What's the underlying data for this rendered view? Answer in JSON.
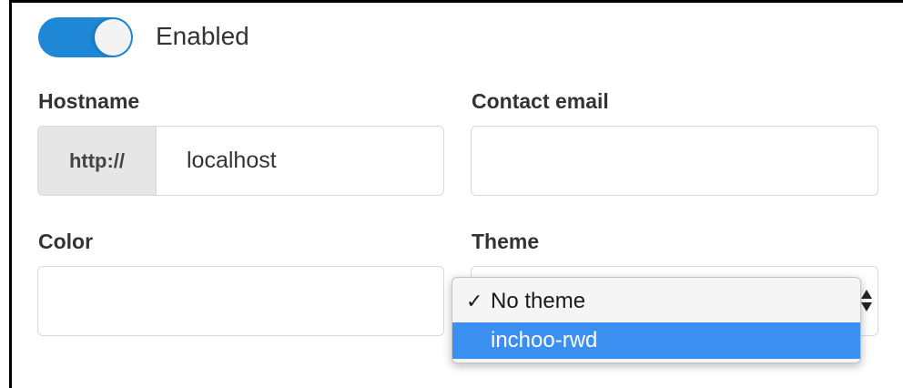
{
  "toggle": {
    "label": "Enabled",
    "state": "on",
    "color": "#1e88d6"
  },
  "hostname": {
    "label": "Hostname",
    "prefix": "http://",
    "value": "localhost"
  },
  "contact_email": {
    "label": "Contact email",
    "value": ""
  },
  "color_field": {
    "label": "Color",
    "value": ""
  },
  "theme": {
    "label": "Theme",
    "options": [
      {
        "label": "No theme",
        "checked": true,
        "check_mark": "✓"
      },
      {
        "label": "inchoo-rwd",
        "highlighted": true
      }
    ],
    "highlight_color": "#3b8ff0"
  }
}
